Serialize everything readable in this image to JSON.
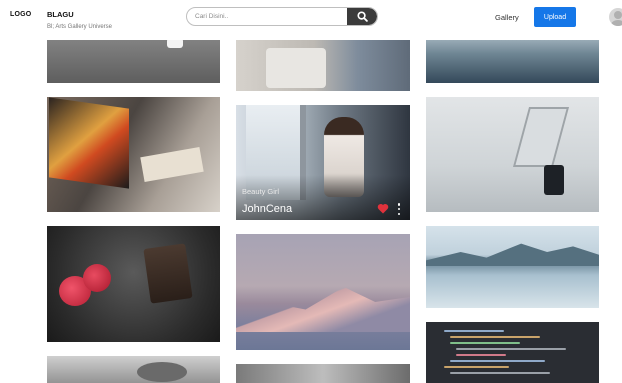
{
  "header": {
    "logo": "LOGO",
    "brand": "BLAGU",
    "tagline": "Bl; Arts Gallery Universe",
    "search_placeholder": "Cari Disini..",
    "nav_gallery": "Gallery",
    "upload_label": "Upload"
  },
  "colors": {
    "accent": "#1577e8",
    "search_button": "#3b3b3b",
    "like": "#e0323c"
  },
  "icons": {
    "search": "search-icon",
    "like": "heart-icon",
    "more": "more-vertical-icon",
    "avatar": "user-avatar-icon"
  },
  "gallery": {
    "featured": {
      "title": "Beauty Girl",
      "author": "JohnCena"
    }
  }
}
